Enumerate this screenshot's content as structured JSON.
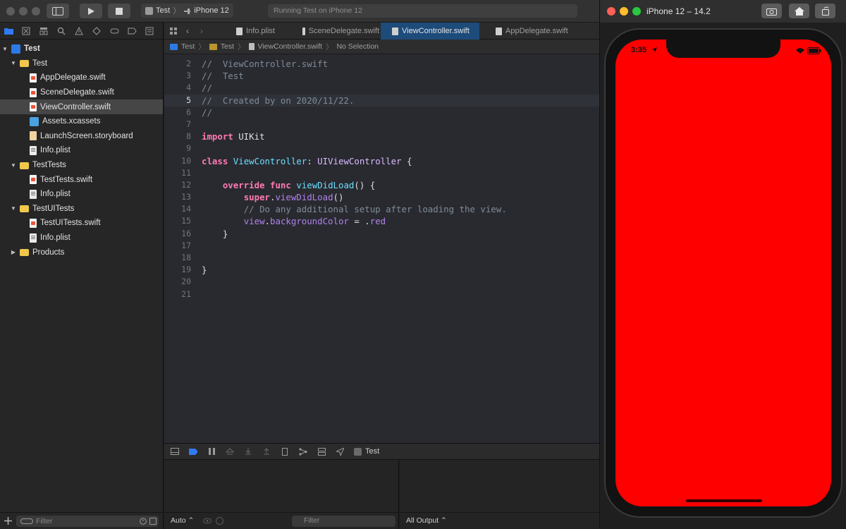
{
  "toolbar": {
    "scheme_name": "Test",
    "destination": "iPhone 12",
    "activity_text": "Running Test on iPhone 12"
  },
  "editor_tabs": [
    {
      "label": "Info.plist"
    },
    {
      "label": "SceneDelegate.swift"
    },
    {
      "label": "ViewController.swift"
    },
    {
      "label": "AppDelegate.swift"
    }
  ],
  "jumpbar": [
    "Test",
    "Test",
    "ViewController.swift",
    "No Selection"
  ],
  "navigator": {
    "items": [
      {
        "label": "Test"
      },
      {
        "label": "Test"
      },
      {
        "label": "AppDelegate.swift"
      },
      {
        "label": "SceneDelegate.swift"
      },
      {
        "label": "ViewController.swift"
      },
      {
        "label": "Assets.xcassets"
      },
      {
        "label": "LaunchScreen.storyboard"
      },
      {
        "label": "Info.plist"
      },
      {
        "label": "TestTests"
      },
      {
        "label": "TestTests.swift"
      },
      {
        "label": "Info.plist"
      },
      {
        "label": "TestUITests"
      },
      {
        "label": "TestUITests.swift"
      },
      {
        "label": "Info.plist"
      },
      {
        "label": "Products"
      }
    ],
    "filter_placeholder": "Filter"
  },
  "code": {
    "lines": [
      {
        "n": "2",
        "text": "//  ViewController.swift"
      },
      {
        "n": "3",
        "text": "//  Test"
      },
      {
        "n": "4",
        "text": "//"
      },
      {
        "n": "5",
        "text": "//  Created by on 2020/11/22."
      },
      {
        "n": "6",
        "text": "//"
      },
      {
        "n": "7",
        "text": ""
      },
      {
        "n": "8",
        "text": "import UIKit"
      },
      {
        "n": "9",
        "text": ""
      },
      {
        "n": "10",
        "text": "class ViewController: UIViewController {"
      },
      {
        "n": "11",
        "text": ""
      },
      {
        "n": "12",
        "text": "    override func viewDidLoad() {"
      },
      {
        "n": "13",
        "text": "        super.viewDidLoad()"
      },
      {
        "n": "14",
        "text": "        // Do any additional setup after loading the view."
      },
      {
        "n": "15",
        "text": "        view.backgroundColor = .red"
      },
      {
        "n": "16",
        "text": "    }"
      },
      {
        "n": "17",
        "text": ""
      },
      {
        "n": "18",
        "text": ""
      },
      {
        "n": "19",
        "text": "}"
      },
      {
        "n": "20",
        "text": ""
      },
      {
        "n": "21",
        "text": ""
      }
    ],
    "tokens": {
      "l2": "//  ViewController.swift",
      "l3": "//  Test",
      "l4": "//",
      "l5": "//  Created by on 2020/11/22.",
      "l6": "//",
      "import_kw": "import",
      "import_mod": " UIKit",
      "class_kw": "class",
      "class_name": "ViewController",
      "colon": ": ",
      "super_type": "UIViewController",
      "brace_open": " {",
      "override_kw": "override",
      "func_kw": "func",
      "fn_name": "viewDidLoad",
      "parens_open": "() {",
      "super_kw": "super",
      "dot": ".",
      "call_name": "viewDidLoad",
      "parens": "()",
      "comment14": "// Do any additional setup after loading the view.",
      "view_name": "view",
      "prop_name": "backgroundColor",
      "assign": " = .",
      "red": "red",
      "close_inner": "}",
      "close_outer": "}"
    }
  },
  "debug": {
    "process_label": "Test",
    "auto_label": "Auto",
    "var_filter_placeholder": "Filter",
    "output_label": "All Output",
    "console_filter_placeholder": "Filter"
  },
  "simulator": {
    "title": "iPhone 12 – 14.2",
    "status_time": "3:35",
    "screen_color": "#ff0000"
  },
  "colors": {
    "accent": "#2f7bf6",
    "keyword": "#ff7ab2",
    "type": "#6bdfff",
    "comment": "#7f8c98"
  }
}
